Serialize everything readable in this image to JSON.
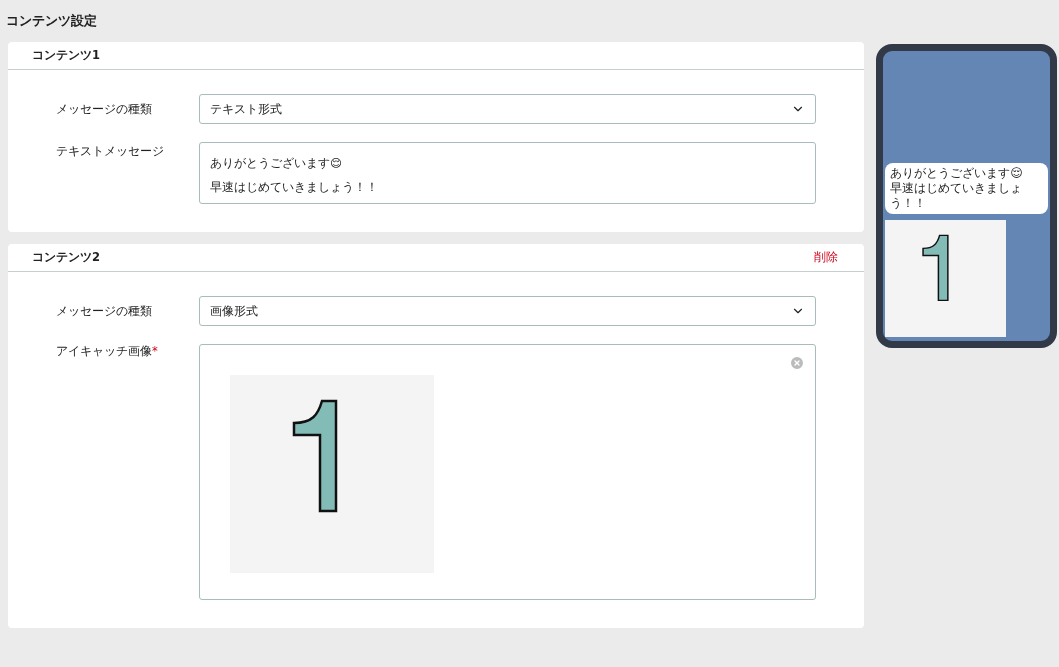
{
  "title": "コンテンツ設定",
  "contents": [
    {
      "title": "コンテンツ1",
      "fields": [
        {
          "kind": "select",
          "label": "メッセージの種類",
          "value": "テキスト形式"
        },
        {
          "kind": "textarea",
          "label": "テキストメッセージ",
          "lines": [
            "ありがとうございます😌",
            "早速はじめていきましょう！！"
          ]
        }
      ]
    },
    {
      "title": "コンテンツ2",
      "delete_label": "削除",
      "fields": [
        {
          "kind": "select",
          "label": "メッセージの種類",
          "value": "画像形式"
        },
        {
          "kind": "image",
          "label": "アイキャッチ画像",
          "required_mark": "*"
        }
      ]
    }
  ],
  "preview": {
    "messages": [
      {
        "kind": "text",
        "lines": [
          "ありがとうございます😌",
          "早速はじめていきましょう！！"
        ]
      },
      {
        "kind": "image"
      }
    ]
  }
}
